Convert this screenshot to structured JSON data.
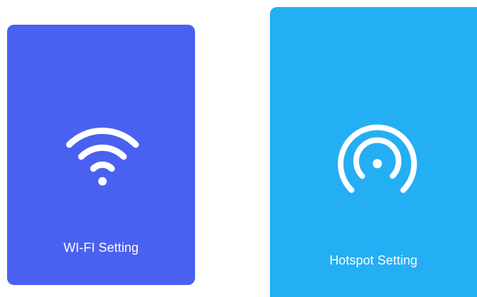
{
  "colors": {
    "wifi_card": "#4a61ef",
    "hotspot_card": "#24aef4",
    "icon": "#ffffff"
  },
  "cards": [
    {
      "label": "WI-FI Setting",
      "icon": "wifi-icon"
    },
    {
      "label": "Hotspot Setting",
      "icon": "hotspot-icon"
    }
  ]
}
